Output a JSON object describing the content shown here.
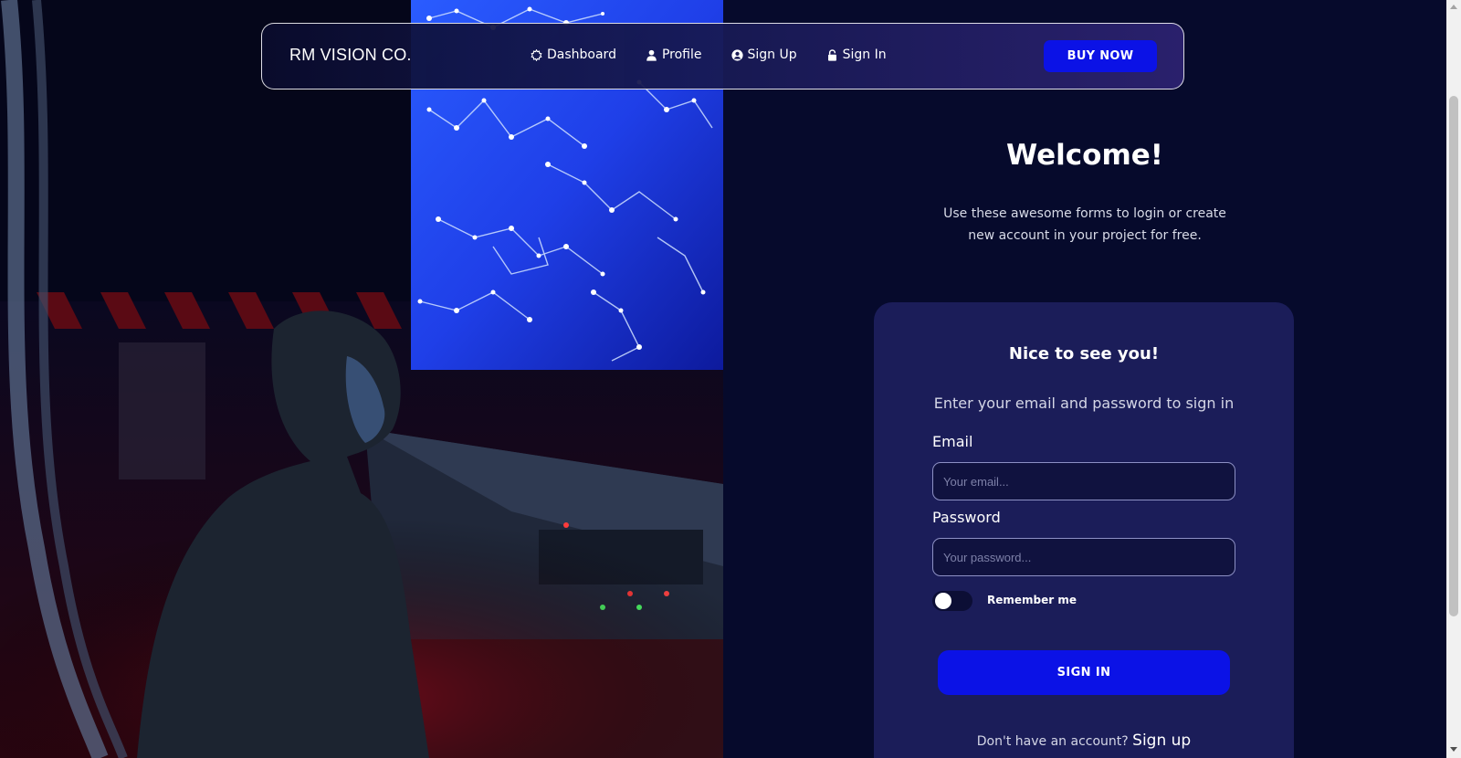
{
  "navbar": {
    "brand": "RM VISION CO.",
    "links": [
      {
        "label": "Dashboard",
        "icon": "dashboard-icon"
      },
      {
        "label": "Profile",
        "icon": "user-icon"
      },
      {
        "label": "Sign Up",
        "icon": "user-circle-icon"
      },
      {
        "label": "Sign In",
        "icon": "lock-icon"
      }
    ],
    "buy_label": "BUY NOW"
  },
  "welcome": {
    "title": "Welcome!",
    "subtitle_line1": "Use these awesome forms to login or create",
    "subtitle_line2": "new account in your project for free."
  },
  "card": {
    "title": "Nice to see you!",
    "subtitle": "Enter your email and password to sign in",
    "email_label": "Email",
    "email_placeholder": "Your email...",
    "password_label": "Password",
    "password_placeholder": "Your password...",
    "remember_label": "Remember me",
    "remember_checked": false,
    "signin_label": "SIGN IN",
    "no_account_text": "Don't have an account?",
    "signup_link": "Sign up"
  },
  "colors": {
    "background": "#060a2c",
    "card": "#1b1d59",
    "accent": "#0b12e6"
  }
}
